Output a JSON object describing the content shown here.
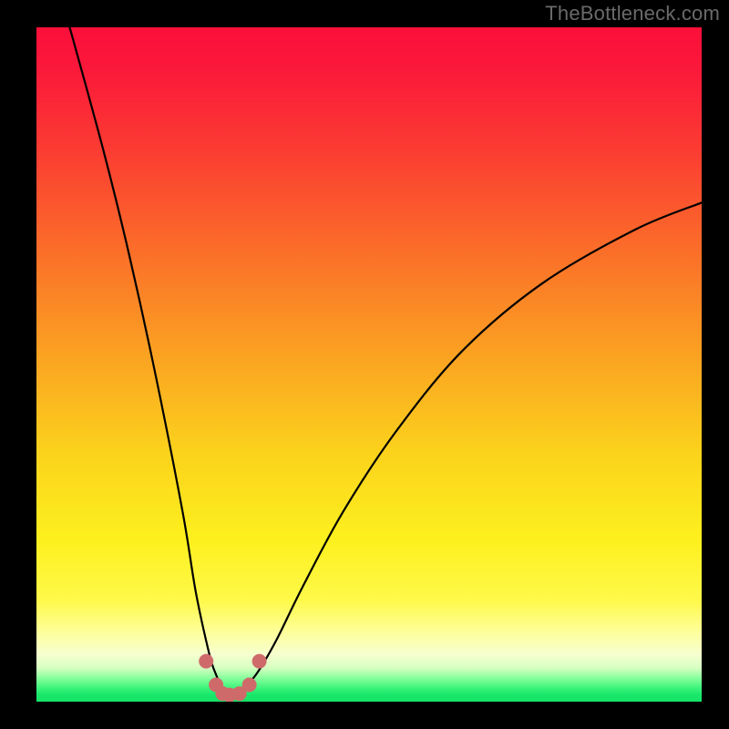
{
  "watermark": "TheBottleneck.com",
  "chart_data": {
    "type": "line",
    "title": "",
    "xlabel": "",
    "ylabel": "",
    "xlim": [
      0,
      100
    ],
    "ylim": [
      0,
      100
    ],
    "gradient_bands": [
      {
        "name": "red",
        "approx_y_range": [
          70,
          100
        ]
      },
      {
        "name": "orange",
        "approx_y_range": [
          40,
          70
        ]
      },
      {
        "name": "yellow",
        "approx_y_range": [
          10,
          40
        ]
      },
      {
        "name": "green",
        "approx_y_range": [
          0,
          5
        ]
      }
    ],
    "series": [
      {
        "name": "bottleneck-curve",
        "x": [
          5,
          10,
          14,
          18,
          22,
          24,
          26,
          27,
          28,
          29,
          30,
          31,
          33,
          36,
          40,
          46,
          54,
          64,
          76,
          90,
          100
        ],
        "y": [
          100,
          82,
          66,
          48,
          28,
          16,
          7,
          4,
          2,
          1,
          1,
          2,
          4,
          9,
          17,
          28,
          40,
          52,
          62,
          70,
          74
        ]
      }
    ],
    "markers": {
      "name": "trough-dots",
      "x": [
        25.5,
        27.0,
        28.0,
        29.0,
        30.5,
        32.0,
        33.5
      ],
      "y": [
        6.0,
        2.5,
        1.2,
        1.0,
        1.2,
        2.5,
        6.0
      ]
    },
    "notes": "Values are estimated from pixel positions; axes are unitless 0–100 since no tick labels are shown."
  }
}
